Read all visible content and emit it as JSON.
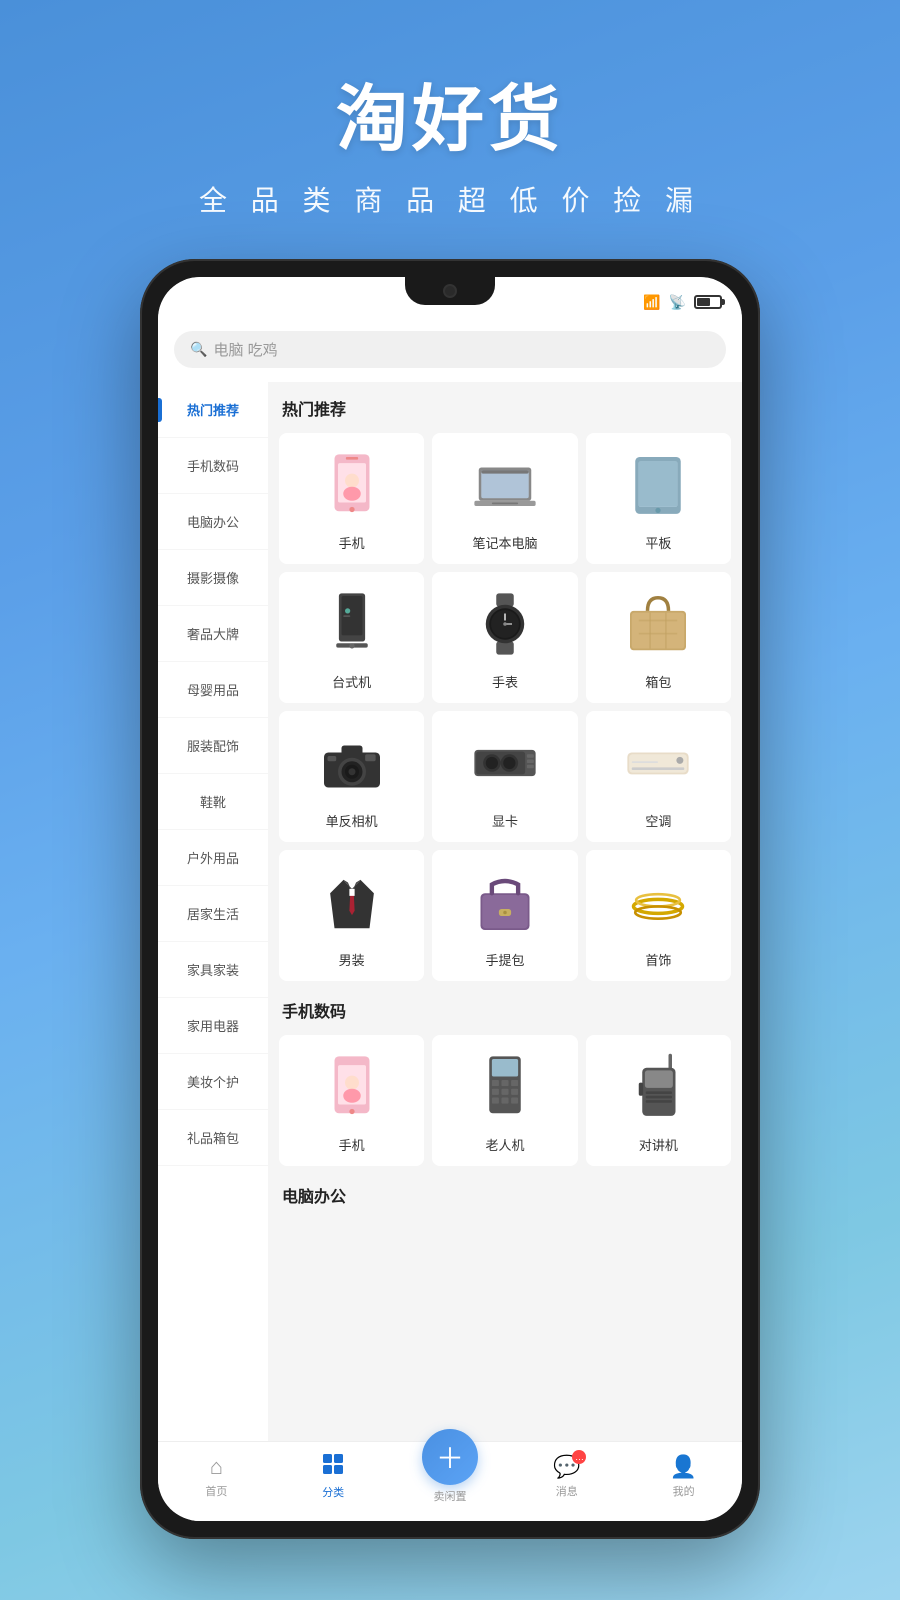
{
  "app": {
    "main_title": "淘好货",
    "sub_title": "全 品 类 商 品  超 低 价 捡 漏"
  },
  "search": {
    "placeholder": "电脑 吃鸡"
  },
  "sidebar": {
    "items": [
      {
        "label": "热门推荐",
        "active": true
      },
      {
        "label": "手机数码",
        "active": false
      },
      {
        "label": "电脑办公",
        "active": false
      },
      {
        "label": "摄影摄像",
        "active": false
      },
      {
        "label": "奢品大牌",
        "active": false
      },
      {
        "label": "母婴用品",
        "active": false
      },
      {
        "label": "服装配饰",
        "active": false
      },
      {
        "label": "鞋靴",
        "active": false
      },
      {
        "label": "户外用品",
        "active": false
      },
      {
        "label": "居家生活",
        "active": false
      },
      {
        "label": "家具家装",
        "active": false
      },
      {
        "label": "家用电器",
        "active": false
      },
      {
        "label": "美妆个护",
        "active": false
      },
      {
        "label": "礼品箱包",
        "active": false
      }
    ]
  },
  "sections": [
    {
      "title": "热门推荐",
      "products": [
        {
          "name": "手机",
          "image_type": "phone"
        },
        {
          "name": "笔记本电脑",
          "image_type": "laptop"
        },
        {
          "name": "平板",
          "image_type": "tablet"
        },
        {
          "name": "台式机",
          "image_type": "desktop"
        },
        {
          "name": "手表",
          "image_type": "watch"
        },
        {
          "name": "箱包",
          "image_type": "bag"
        },
        {
          "name": "单反相机",
          "image_type": "camera"
        },
        {
          "name": "显卡",
          "image_type": "gpu"
        },
        {
          "name": "空调",
          "image_type": "ac"
        },
        {
          "name": "男装",
          "image_type": "suit"
        },
        {
          "name": "手提包",
          "image_type": "handbag"
        },
        {
          "name": "首饰",
          "image_type": "jewelry"
        }
      ]
    },
    {
      "title": "手机数码",
      "products": [
        {
          "name": "手机",
          "image_type": "phone"
        },
        {
          "name": "老人机",
          "image_type": "elder_phone"
        },
        {
          "name": "对讲机",
          "image_type": "walkie_talkie"
        }
      ]
    },
    {
      "title": "电脑办公",
      "products": []
    }
  ],
  "bottom_nav": {
    "items": [
      {
        "label": "首页",
        "icon": "home",
        "active": false
      },
      {
        "label": "分类",
        "icon": "grid",
        "active": true
      },
      {
        "label": "卖闲置",
        "icon": "plus",
        "fab": true
      },
      {
        "label": "消息",
        "icon": "chat",
        "active": false,
        "badge": "..."
      },
      {
        "label": "我的",
        "icon": "user",
        "active": false
      }
    ]
  }
}
